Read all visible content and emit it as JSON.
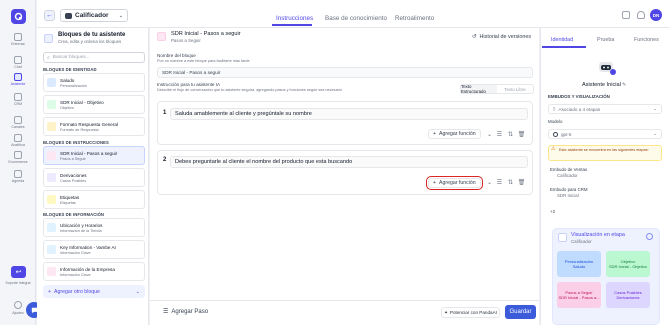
{
  "sidebar": {
    "items": [
      {
        "label": "Entrenar",
        "icon": "book-icon"
      },
      {
        "label": "Chat",
        "icon": "chat-icon"
      },
      {
        "label": "Asistente",
        "icon": "assistant-icon",
        "active": true
      },
      {
        "label": "CRM",
        "icon": "crm-icon"
      },
      {
        "label": "Canales",
        "icon": "channels-icon"
      },
      {
        "label": "Analítica",
        "icon": "analytics-icon"
      },
      {
        "label": "Ecommerce",
        "icon": "cart-icon"
      },
      {
        "label": "Agenda",
        "icon": "calendar-icon"
      }
    ],
    "help": "Soporte Integral",
    "settings": "Ajustes"
  },
  "topbar": {
    "agent": "Calificador",
    "tabs": [
      "Instrucciones",
      "Base de conocimiento",
      "Retroalimento"
    ],
    "user": "DN"
  },
  "blocks": {
    "title": "Bloques de tu asistente",
    "subtitle": "Crea, edita y ordena los bloques",
    "search_placeholder": "Buscar bloques...",
    "sections": [
      {
        "name": "BLOQUES DE IDENTIDAD",
        "items": [
          {
            "title": "Saludo",
            "sub": "Personalización",
            "color": "#dbeafe"
          },
          {
            "title": "SDR Inicial - Objetivo",
            "sub": "Objetivo",
            "color": "#dcfce7"
          },
          {
            "title": "Formato Respuesta General",
            "sub": "Formato de Respuesta",
            "color": "#fef3c7"
          }
        ]
      },
      {
        "name": "BLOQUES DE INSTRUCCIONES",
        "items": [
          {
            "title": "SDR Inicial - Pasos a seguir",
            "sub": "Pasos a Seguir",
            "color": "#fce7f3",
            "selected": true
          },
          {
            "title": "Derivaciones",
            "sub": "Casos Posibles",
            "color": "#ede9fe"
          },
          {
            "title": "Etiquetas",
            "sub": "Etiquetas",
            "color": "#fef9c3"
          }
        ]
      },
      {
        "name": "BLOQUES DE INFORMACIÓN",
        "items": [
          {
            "title": "Ubicación y Horarios",
            "sub": "Información de la Tienda",
            "color": "#e0f2fe"
          },
          {
            "title": "Key Information - Vambe AI",
            "sub": "Información Clave",
            "color": "#e0f2fe"
          },
          {
            "title": "Información de la Empresa",
            "sub": "Información Clave",
            "color": "#fce7f3"
          }
        ]
      }
    ],
    "add_label": "Agregar otro bloque"
  },
  "editor": {
    "block_title": "SDR Inicial - Pasos a seguir",
    "block_sub": "Pasos a Seguir",
    "history": "Historial de versiones",
    "name_label": "Nombre del bloque",
    "name_hint": "Pon un nombre a este bloque para facilitarte más tarde",
    "name_value": "SDR Inicial - Pasos a seguir",
    "instr_label": "Instrucción para tu asistente IA",
    "instr_hint": "Describe el flujo de conversación que tu asistente seguirá, agregando pasos y funciones según sea necesario",
    "mode_on": "Texto Estructurado",
    "mode_off": "Texto Libre",
    "steps": [
      {
        "num": "1",
        "text": "Saluda amablemente al cliente y pregúntale su nombre",
        "btn": "Agregar función"
      },
      {
        "num": "2",
        "text": "Debes preguntarle al cliente el nombre del producto que esta buscando",
        "btn": "Agregar función"
      }
    ],
    "add_step": "Agregar Paso",
    "improve": "Potenciar con PandaAI",
    "save": "Guardar"
  },
  "right": {
    "tabs": [
      "Identidad",
      "Prueba",
      "Funciones"
    ],
    "assistant_name": "Asistente Inicial",
    "embudos_label": "EMBUDOS Y VISUALIZACIÓN",
    "embudos_value": "Asociado a 4 etapas",
    "model_label": "Modelo",
    "model_value": "gpt-5",
    "warning": "Este asistente se encuentra en las siguientes etapas:",
    "funnels": [
      {
        "label": "Embudo de Ventas",
        "stage": "Calificador"
      },
      {
        "label": "Embudo para CRM",
        "stage": "SDR Inicial"
      }
    ],
    "more": "+2",
    "viz": {
      "title": "Visualización en etapa",
      "sub": "Calificador",
      "cards": [
        {
          "title": "Personalización",
          "sub": "Saludo",
          "color": "#bfdbfe",
          "ink": "#1d4ed8"
        },
        {
          "title": "Objetivo",
          "sub": "SDR Inicial - Objetivo",
          "color": "#bbf7d0",
          "ink": "#15803d"
        },
        {
          "title": "Pasos a Seguir",
          "sub": "SDR Inicial - Pasos a...",
          "color": "#fbcfe8",
          "ink": "#be185d"
        },
        {
          "title": "Casos Posibles",
          "sub": "Derivaciones",
          "color": "#ddd6fe",
          "ink": "#6d28d9"
        }
      ]
    }
  }
}
